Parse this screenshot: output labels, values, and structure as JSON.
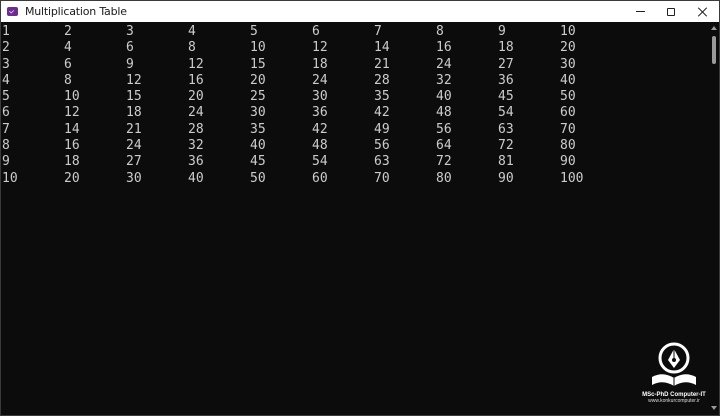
{
  "window": {
    "title": "Multiplication Table",
    "icon": "terminal-app-icon",
    "controls": [
      "minimize-icon",
      "maximize-icon",
      "close-icon"
    ]
  },
  "console": {
    "rows": [
      [
        "1",
        "2",
        "3",
        "4",
        "5",
        "6",
        "7",
        "8",
        "9",
        "10"
      ],
      [
        "2",
        "4",
        "6",
        "8",
        "10",
        "12",
        "14",
        "16",
        "18",
        "20"
      ],
      [
        "3",
        "6",
        "9",
        "12",
        "15",
        "18",
        "21",
        "24",
        "27",
        "30"
      ],
      [
        "4",
        "8",
        "12",
        "16",
        "20",
        "24",
        "28",
        "32",
        "36",
        "40"
      ],
      [
        "5",
        "10",
        "15",
        "20",
        "25",
        "30",
        "35",
        "40",
        "45",
        "50"
      ],
      [
        "6",
        "12",
        "18",
        "24",
        "30",
        "36",
        "42",
        "48",
        "54",
        "60"
      ],
      [
        "7",
        "14",
        "21",
        "28",
        "35",
        "42",
        "49",
        "56",
        "63",
        "70"
      ],
      [
        "8",
        "16",
        "24",
        "32",
        "40",
        "48",
        "56",
        "64",
        "72",
        "80"
      ],
      [
        "9",
        "18",
        "27",
        "36",
        "45",
        "54",
        "63",
        "72",
        "81",
        "90"
      ],
      [
        "10",
        "20",
        "30",
        "40",
        "50",
        "60",
        "70",
        "80",
        "90",
        "100"
      ]
    ]
  },
  "watermark": {
    "line1": "MSc-PhD Computer-IT",
    "line2": "www.konkurcomputer.ir"
  },
  "colors": {
    "background": "#0c0c0c",
    "text": "#cccccc",
    "titlebar": "#ffffff"
  }
}
